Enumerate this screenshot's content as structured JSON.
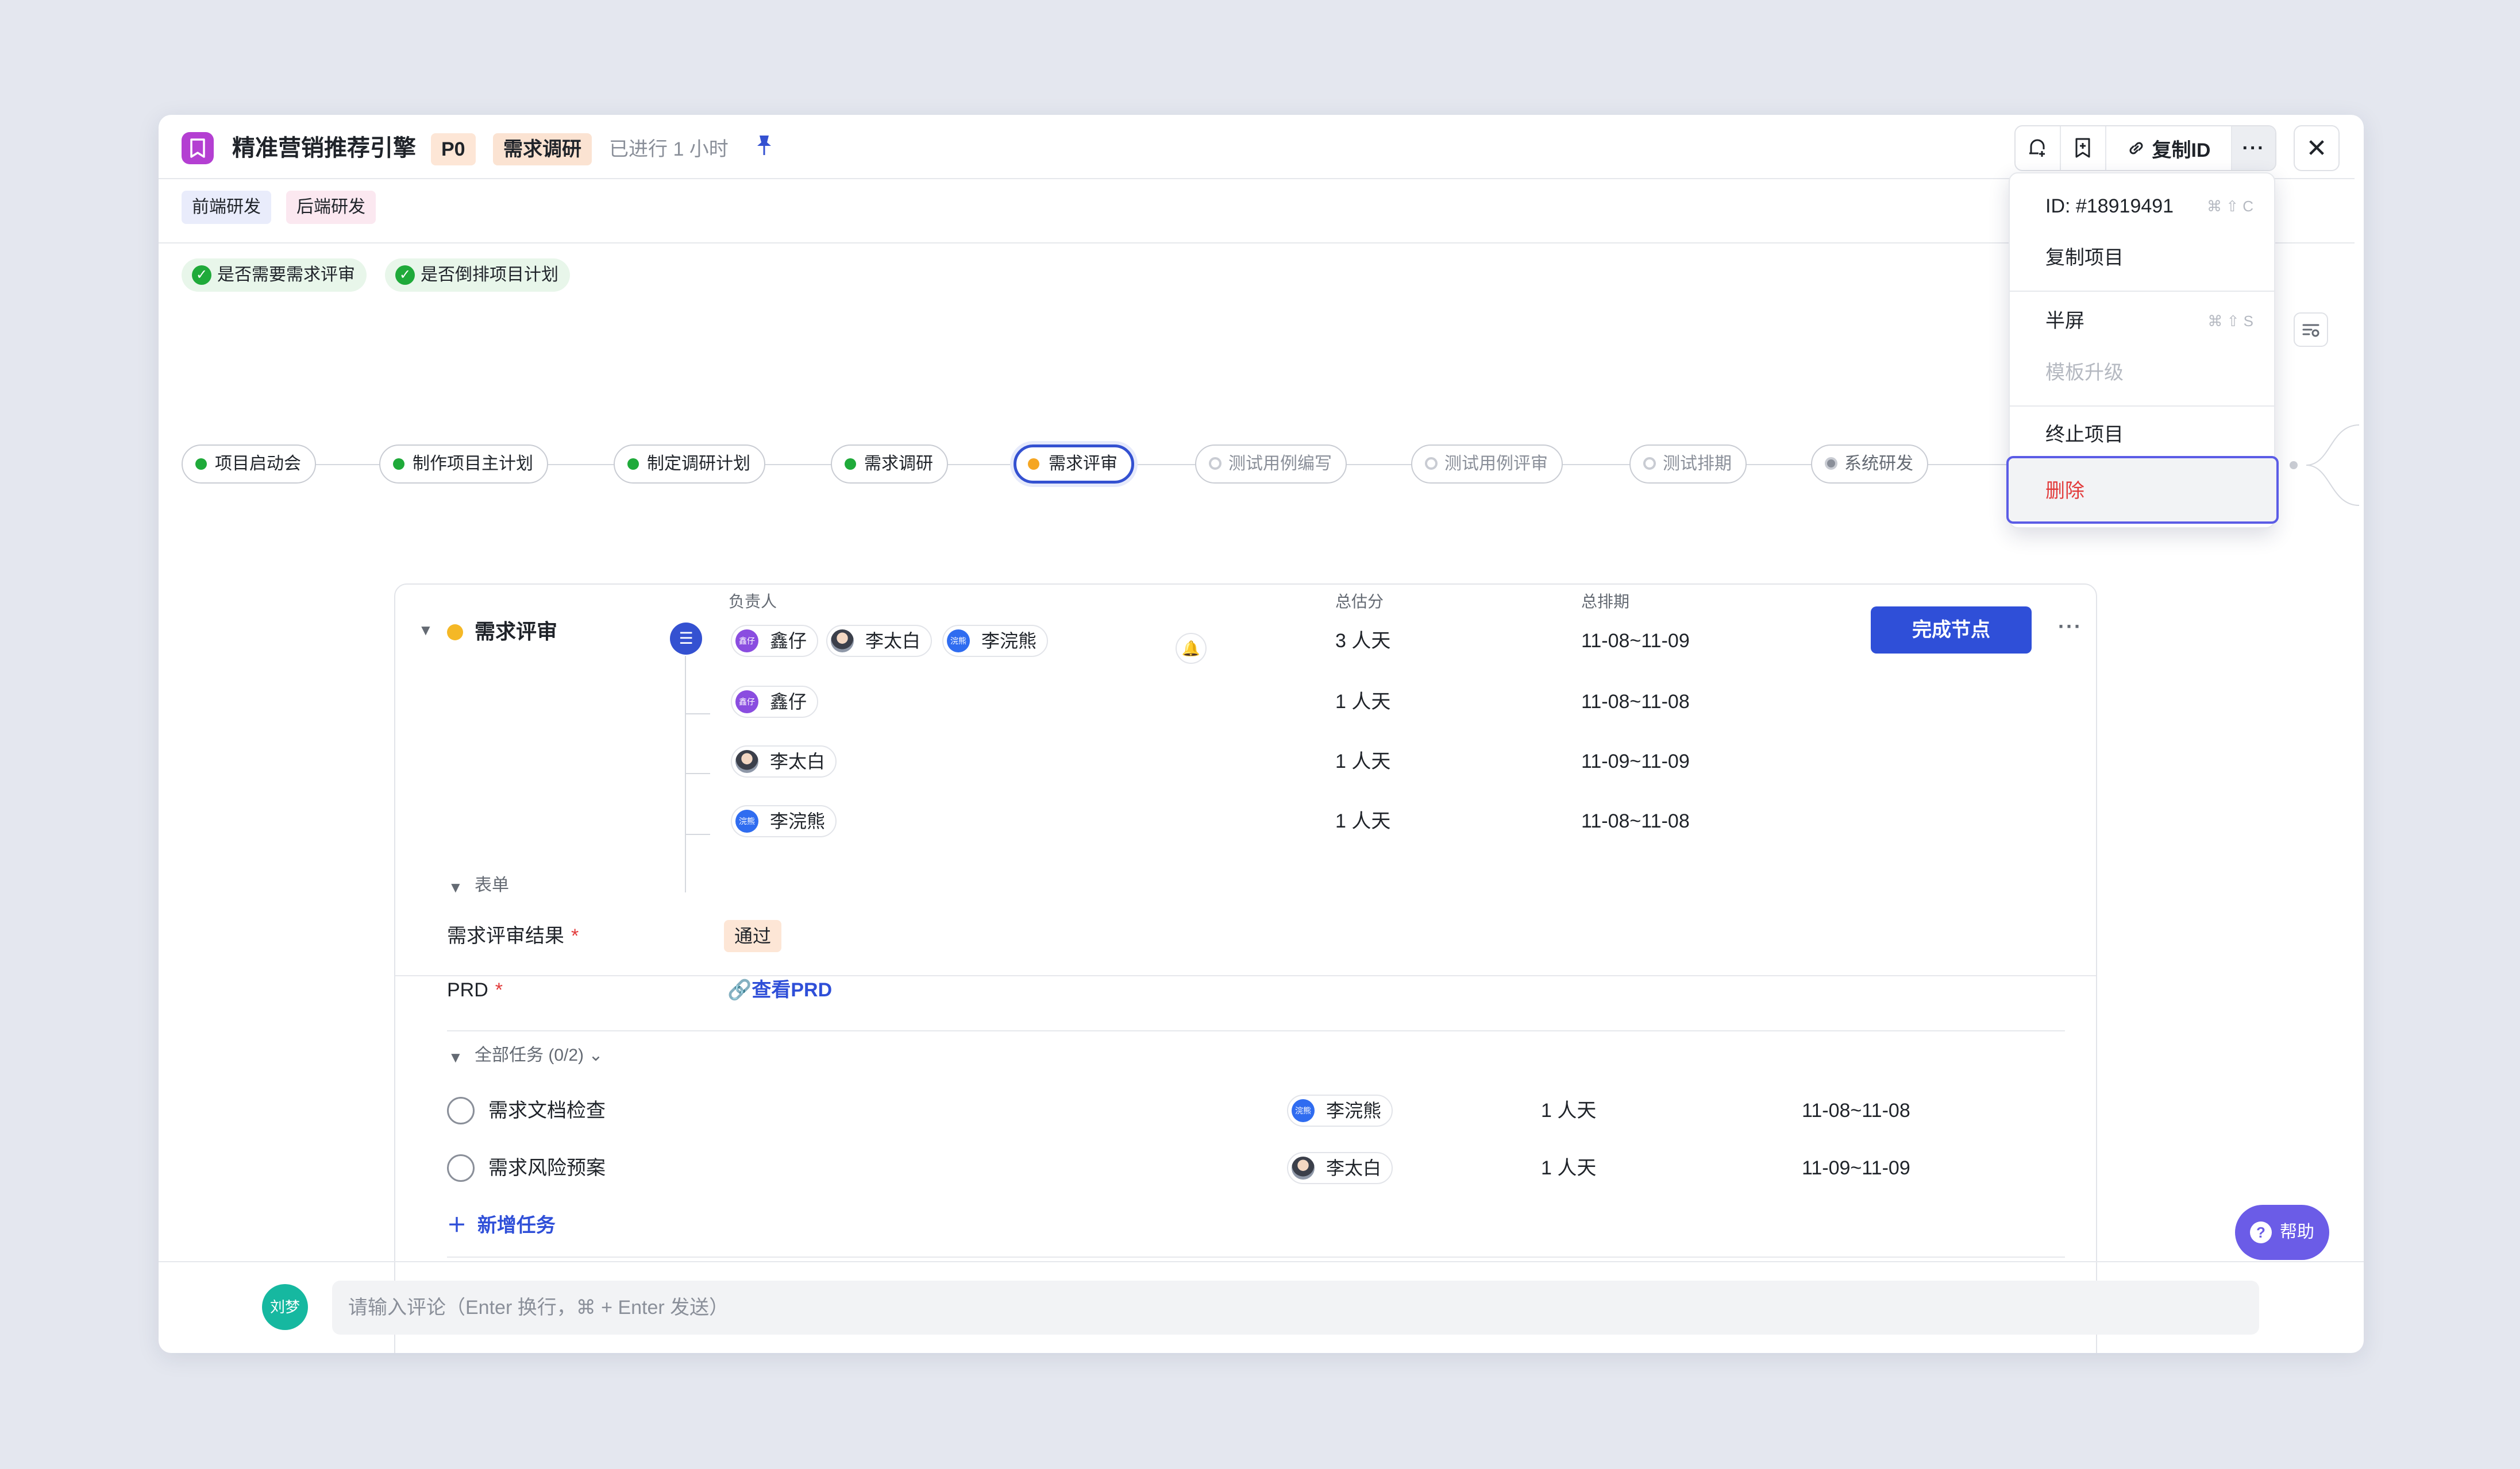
{
  "header": {
    "title": "精准营销推荐引擎",
    "priority": "P0",
    "stage": "需求调研",
    "elapsed": "已进行 1 小时",
    "copy_id_label": "复制ID",
    "more_label": "···",
    "close_label": "✕"
  },
  "departments": [
    "前端研发",
    "后端研发"
  ],
  "checks": [
    "是否需要需求评审",
    "是否倒排项目计划"
  ],
  "flow": {
    "nodes": [
      {
        "label": "项目启动会",
        "state": "done"
      },
      {
        "label": "制作项目主计划",
        "state": "done"
      },
      {
        "label": "制定调研计划",
        "state": "done"
      },
      {
        "label": "需求调研",
        "state": "done"
      },
      {
        "label": "需求评审",
        "state": "active"
      },
      {
        "label": "测试用例编写",
        "state": "todo"
      },
      {
        "label": "测试用例评审",
        "state": "todo"
      },
      {
        "label": "测试排期",
        "state": "todo"
      },
      {
        "label": "系统研发",
        "state": "progress"
      }
    ]
  },
  "node_detail": {
    "title": "需求评审",
    "col_owner": "负责人",
    "col_estimate": "总估分",
    "col_schedule": "总排期",
    "complete_label": "完成节点",
    "more_label": "···",
    "summary": {
      "owners": [
        {
          "name": "鑫仔",
          "avatar_text": "鑫仔",
          "avatar": "purple"
        },
        {
          "name": "李太白",
          "avatar_text": "",
          "avatar": "photo"
        },
        {
          "name": "李浣熊",
          "avatar_text": "浣熊",
          "avatar": "blue"
        }
      ],
      "estimate": "3 人天",
      "schedule": "11-08~11-09"
    },
    "rows": [
      {
        "name": "鑫仔",
        "avatar_text": "鑫仔",
        "avatar": "purple",
        "estimate": "1 人天",
        "schedule": "11-08~11-08"
      },
      {
        "name": "李太白",
        "avatar_text": "",
        "avatar": "photo",
        "estimate": "1 人天",
        "schedule": "11-09~11-09"
      },
      {
        "name": "李浣熊",
        "avatar_text": "浣熊",
        "avatar": "blue",
        "estimate": "1 人天",
        "schedule": "11-08~11-08"
      }
    ],
    "form": {
      "section_label": "表单",
      "review_result_label": "需求评审结果",
      "review_result_value": "通过",
      "prd_label": "PRD",
      "prd_link": "查看PRD",
      "required_mark": "*"
    },
    "tasks": {
      "section_label": "全部任务 (0/2)",
      "items": [
        {
          "name": "需求文档检查",
          "owner": "李浣熊",
          "avatar_text": "浣熊",
          "avatar": "blue",
          "estimate": "1 人天",
          "schedule": "11-08~11-08"
        },
        {
          "name": "需求风险预案",
          "owner": "李太白",
          "avatar_text": "",
          "avatar": "photo",
          "estimate": "1 人天",
          "schedule": "11-09~11-09"
        }
      ],
      "add_label": "新增任务"
    }
  },
  "footer": {
    "user_avatar": "刘梦",
    "comment_placeholder": "请输入评论（Enter 换行，⌘ + Enter 发送）",
    "help_label": "帮助"
  },
  "dropdown": {
    "items": [
      {
        "label": "ID: #18919491",
        "shortcut": "⌘ ⇧ C"
      },
      {
        "label": "复制项目",
        "shortcut": ""
      },
      {
        "label": "半屏",
        "shortcut": "⌘ ⇧ S"
      },
      {
        "label": "模板升级",
        "shortcut": "",
        "disabled": true
      },
      {
        "label": "终止项目",
        "shortcut": ""
      },
      {
        "label": "删除",
        "shortcut": "",
        "danger": true
      }
    ]
  },
  "colors": {
    "accent": "#2f4fd8",
    "done": "#1faa3a",
    "active_node": "#3451d1",
    "danger": "#e23b3b"
  }
}
